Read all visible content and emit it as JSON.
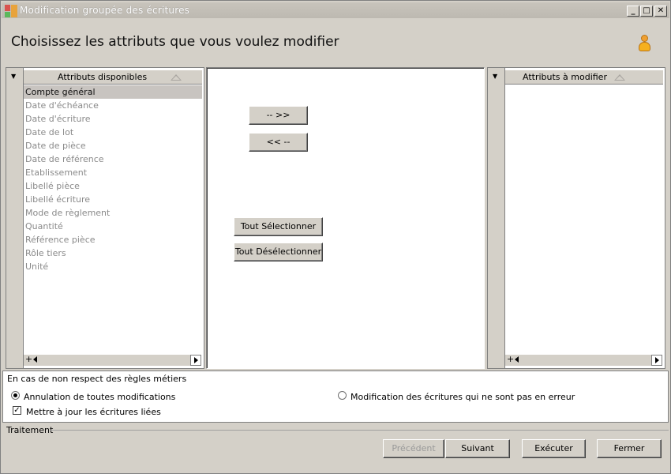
{
  "window": {
    "title": "Modification groupée des écritures",
    "minimize": "_",
    "maximize": "□",
    "close": "✕"
  },
  "heading": "Choisissez les attributs que vous voulez modifier",
  "available_list": {
    "header": "Attributs disponibles",
    "items": [
      "Compte général",
      "Date d'échéance",
      "Date d'écriture",
      "Date de lot",
      "Date de pièce",
      "Date de référence",
      "Etablissement",
      "Libellé pièce",
      "Libellé écriture",
      "Mode de règlement",
      "Quantité",
      "Référence pièce",
      "Rôle tiers",
      "Unité"
    ],
    "selected_index": 0,
    "add_symbol": "+"
  },
  "modify_list": {
    "header": "Attributs à modifier",
    "items": [],
    "add_symbol": "+"
  },
  "middle": {
    "add_button": "-- >>",
    "remove_button": "<< --",
    "select_all": "Tout Sélectionner",
    "deselect_all": "Tout Désélectionner"
  },
  "options": {
    "caption": "En cas de non respect des règles métiers",
    "radio_cancel_all": "Annulation de toutes modifications",
    "radio_cancel_all_checked": true,
    "radio_modify_valid": "Modification des écritures qui ne sont pas en erreur",
    "radio_modify_valid_checked": false,
    "checkbox_update_linked": "Mettre à jour les écritures liées",
    "checkbox_update_linked_checked": true
  },
  "footer": {
    "section_label": "Traitement",
    "previous": "Précédent",
    "previous_enabled": false,
    "next": "Suivant",
    "execute": "Exécuter",
    "close": "Fermer"
  },
  "icons": {
    "app": "app-logo-icon",
    "user": "user-icon",
    "dropdown": "triangle-down-icon",
    "sort": "sort-up-icon",
    "scroll_left": "arrow-left-icon",
    "scroll_right": "arrow-right-icon"
  }
}
